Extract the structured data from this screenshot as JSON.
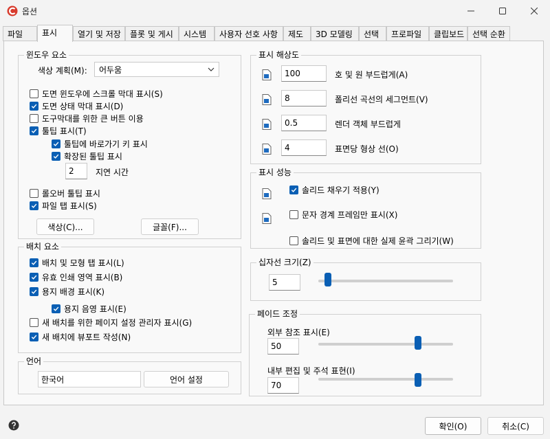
{
  "window": {
    "title": "옵션",
    "logo_icon": "app-logo-icon"
  },
  "tabs": [
    {
      "label": "파일"
    },
    {
      "label": "표시"
    },
    {
      "label": "열기 및 저장"
    },
    {
      "label": "플롯 및 게시"
    },
    {
      "label": "시스템"
    },
    {
      "label": "사용자 선호 사항"
    },
    {
      "label": "제도"
    },
    {
      "label": "3D 모델링"
    },
    {
      "label": "선택"
    },
    {
      "label": "프로파일"
    },
    {
      "label": "클립보드"
    },
    {
      "label": "선택 순환"
    }
  ],
  "window_elements": {
    "title": "윈도우 요소",
    "color_scheme_label": "색상 계획(M):",
    "color_scheme_value": "어두움",
    "checkboxes": [
      {
        "label": "도면 윈도우에 스크롤 막대 표시(S)",
        "checked": false
      },
      {
        "label": "도면 상태 막대 표시(D)",
        "checked": true
      },
      {
        "label": "도구막대를 위한 큰 버튼 이용",
        "checked": false
      },
      {
        "label": "툴팁 표시(T)",
        "checked": true
      },
      {
        "label": "툴팁에 바로가기 키 표시",
        "checked": true
      },
      {
        "label": "확장된 툴팁 표시",
        "checked": true
      }
    ],
    "delay_value": "2",
    "delay_label": "지연 시간",
    "rollover_label": "롤오버 툴팁 표시",
    "rollover_checked": false,
    "file_tabs_label": "파일 탭 표시(S)",
    "file_tabs_checked": true,
    "colors_button": "색상(C)...",
    "fonts_button": "글꼴(F)..."
  },
  "layout_elements": {
    "title": "배치 요소",
    "checkboxes": [
      {
        "label": "배치 및 모형 탭 표시(L)",
        "checked": true
      },
      {
        "label": "유효 인쇄 영역 표시(B)",
        "checked": true
      },
      {
        "label": "용지 배경 표시(K)",
        "checked": true
      },
      {
        "label": "용지 음영 표시(E)",
        "checked": true
      },
      {
        "label": "새 배치를 위한 페이지 설정 관리자 표시(G)",
        "checked": false
      },
      {
        "label": "새 배치에 뷰포트 작성(N)",
        "checked": true
      }
    ]
  },
  "language": {
    "title": "언어",
    "value": "한국어",
    "button": "언어 설정"
  },
  "resolution": {
    "title": "표시 해상도",
    "rows": [
      {
        "value": "100",
        "label": "호 및 원 부드럽게(A)"
      },
      {
        "value": "8",
        "label": "폴리선 곡선의 세그먼트(V)"
      },
      {
        "value": "0.5",
        "label": "렌더  객체 부드럽게"
      },
      {
        "value": "4",
        "label": "표면당 형상 선(O)"
      }
    ]
  },
  "performance": {
    "title": "표시 성능",
    "checkboxes": [
      {
        "label": "솔리드 채우기 적용(Y)",
        "checked": true
      },
      {
        "label": "문자 경계 프레임만 표시(X)",
        "checked": false
      },
      {
        "label": "솔리드 및 표면에 대한 실제 윤곽 그리기(W)",
        "checked": false
      }
    ]
  },
  "crosshair": {
    "title": "십자선 크기(Z)",
    "value": "5",
    "slider_fraction": 0.05
  },
  "fade": {
    "title": "페이드 조정",
    "xref_label": "외부 참조 표시(E)",
    "xref_value": "50",
    "xref_fraction": 0.75,
    "inplace_label": "내부 편집 및 주석 표현(I)",
    "inplace_value": "70",
    "inplace_fraction": 0.75
  },
  "footer": {
    "ok": "확인(O)",
    "cancel": "취소(C)",
    "help_icon": "help-icon"
  },
  "colors": {
    "accent": "#0a5fb4",
    "logo": "#d83b2d"
  }
}
